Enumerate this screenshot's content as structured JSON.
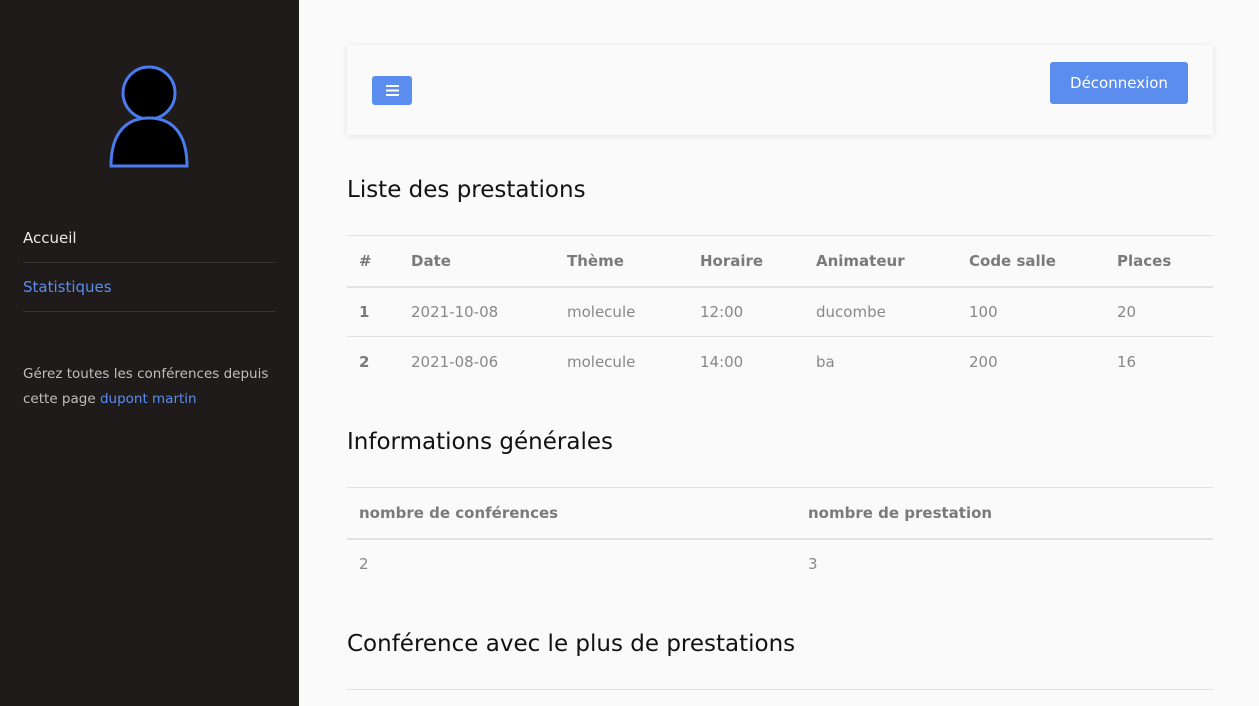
{
  "sidebar": {
    "nav": [
      {
        "label": "Accueil",
        "active": false
      },
      {
        "label": "Statistiques",
        "active": true
      }
    ],
    "footer_text": "Gérez toutes les conférences depuis cette page",
    "footer_user": "dupont martin"
  },
  "topbar": {
    "menu_icon": "bars-icon",
    "logout_label": "Déconnexion"
  },
  "colors": {
    "accent": "#5b8def",
    "sidebar_bg": "#1f1b1a"
  },
  "section1": {
    "title": "Liste des prestations",
    "headers": [
      "#",
      "Date",
      "Thème",
      "Horaire",
      "Animateur",
      "Code salle",
      "Places"
    ],
    "rows": [
      [
        "1",
        "2021-10-08",
        "molecule",
        "12:00",
        "ducombe",
        "100",
        "20"
      ],
      [
        "2",
        "2021-08-06",
        "molecule",
        "14:00",
        "ba",
        "200",
        "16"
      ]
    ]
  },
  "section2": {
    "title": "Informations générales",
    "headers": [
      "nombre de conférences",
      "nombre de prestation"
    ],
    "rows": [
      [
        "2",
        "3"
      ]
    ]
  },
  "section3": {
    "title": "Conférence avec le plus de prestations"
  }
}
